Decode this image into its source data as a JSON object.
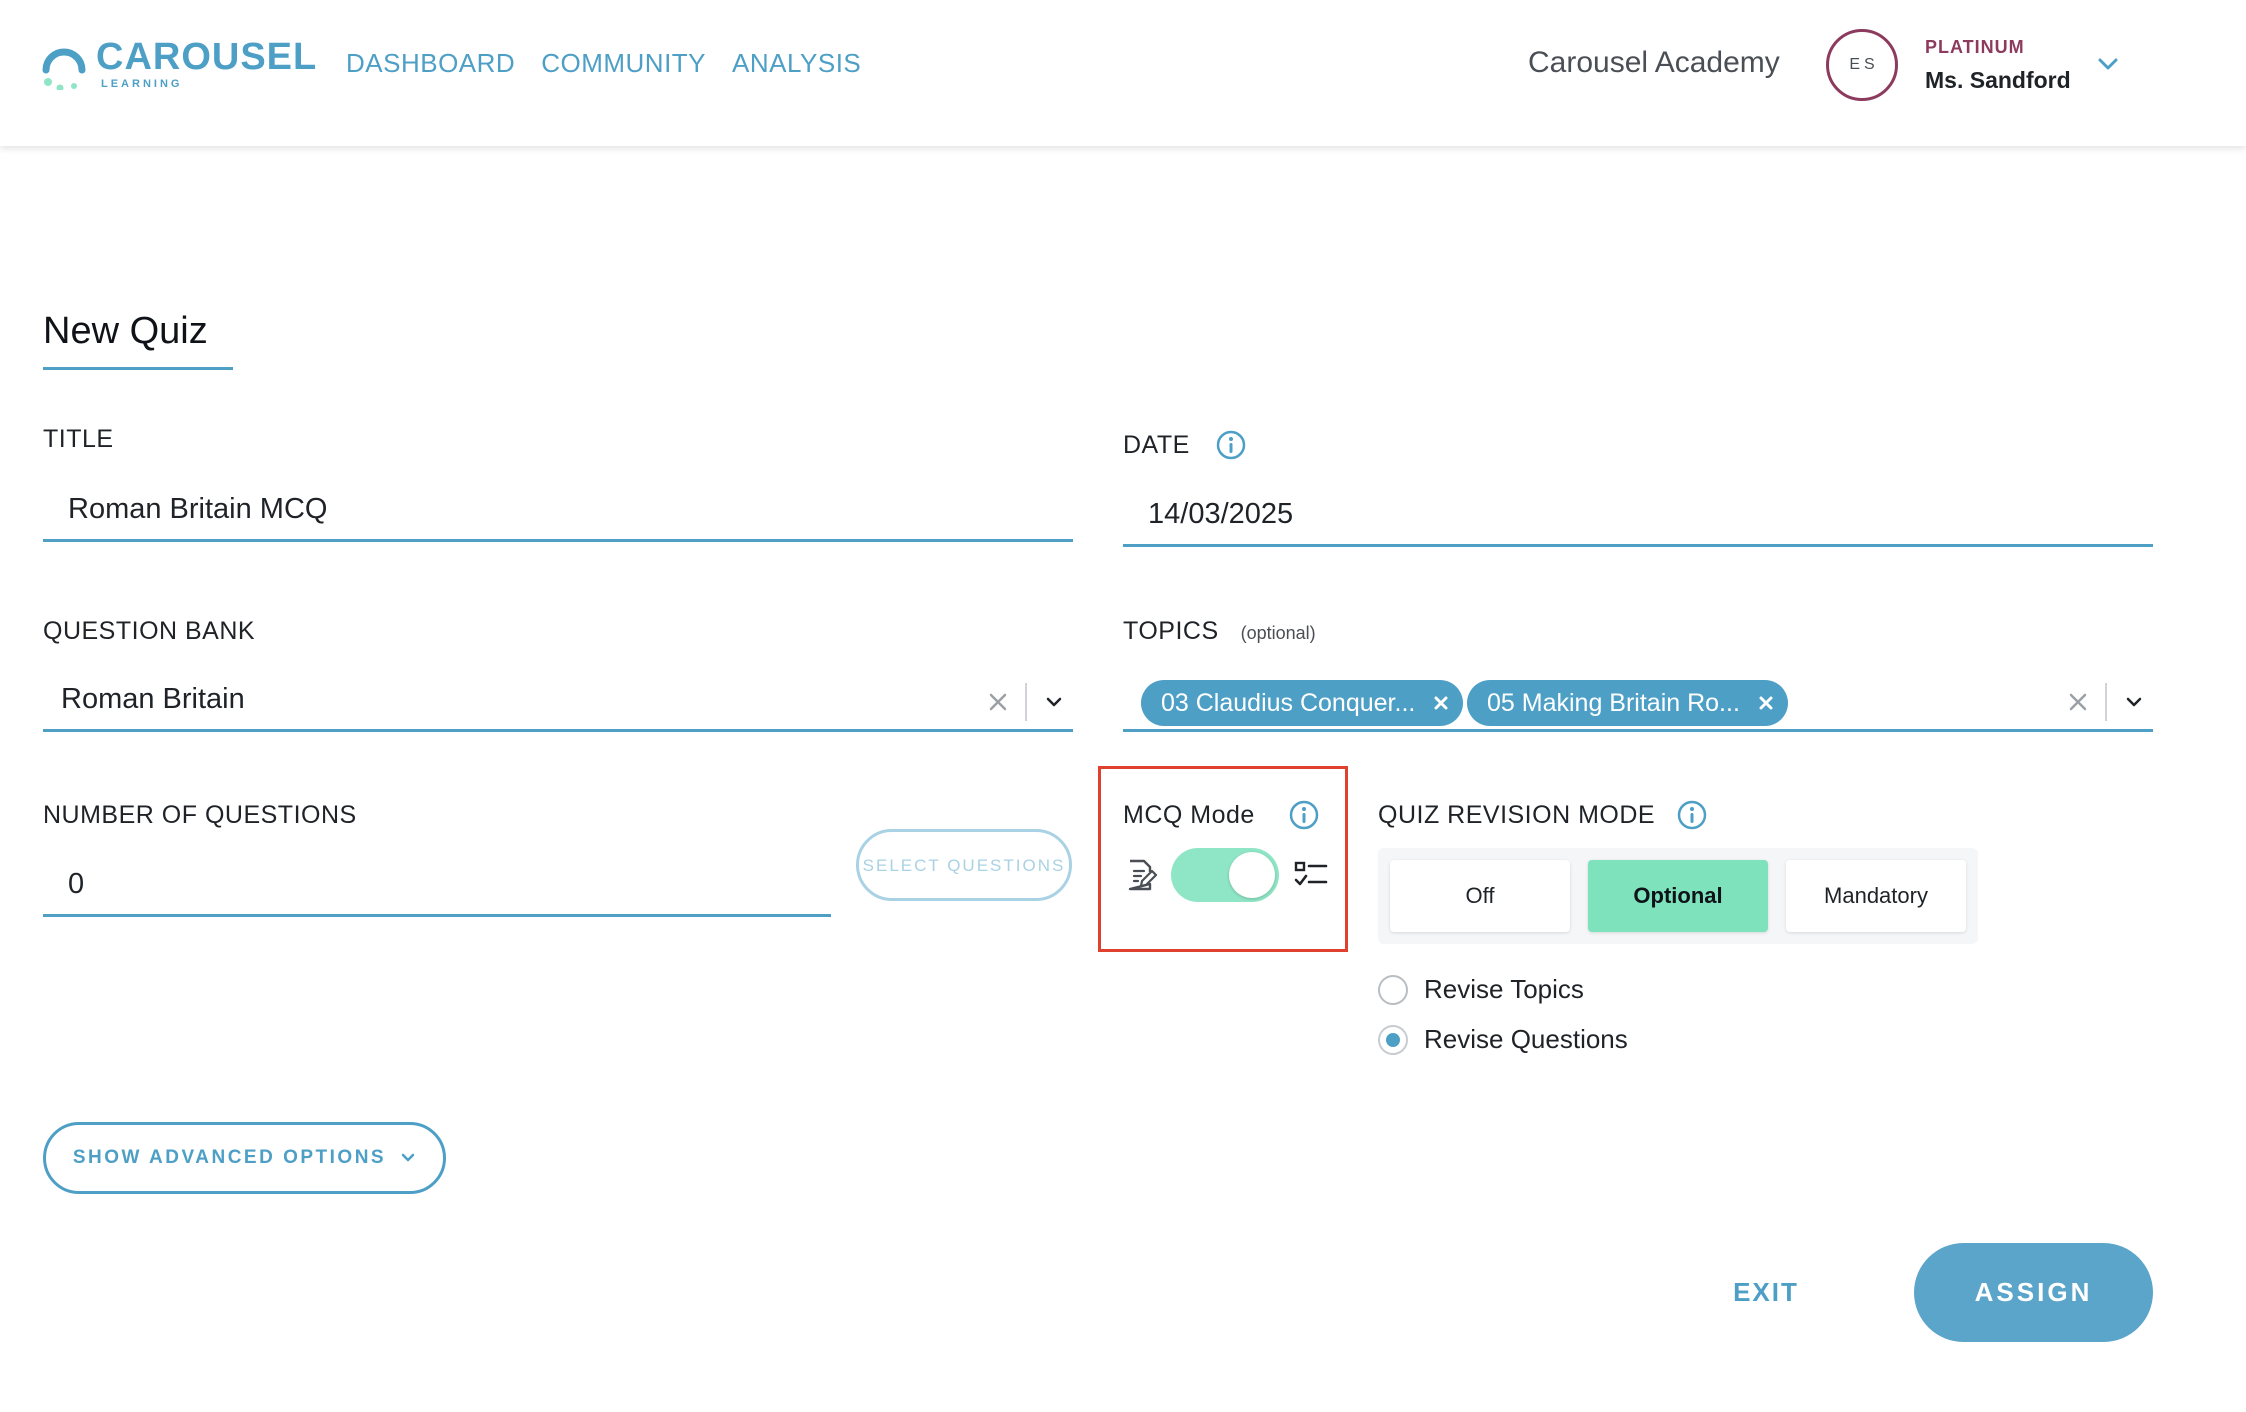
{
  "header": {
    "brand": "CAROUSEL",
    "brand_sub": "LEARNING",
    "nav": [
      "DASHBOARD",
      "COMMUNITY",
      "ANALYSIS"
    ],
    "school": "Carousel Academy",
    "avatar_initials": "ES",
    "plan": "PLATINUM",
    "user_name": "Ms. Sandford"
  },
  "page": {
    "title": "New Quiz"
  },
  "form": {
    "title_label": "TITLE",
    "title_value": "Roman Britain MCQ",
    "date_label": "DATE",
    "date_value": "14/03/2025",
    "bank_label": "QUESTION BANK",
    "bank_value": "Roman Britain",
    "topics_label": "TOPICS",
    "topics_optional": "(optional)",
    "topics": [
      "03 Claudius Conquer...",
      "05 Making Britain Ro..."
    ],
    "num_label": "NUMBER OF QUESTIONS",
    "num_value": "0",
    "select_questions": "SELECT QUESTIONS",
    "mcq_label": "MCQ Mode",
    "mcq_enabled": true,
    "revision_label": "QUIZ REVISION MODE",
    "revision_options": [
      "Off",
      "Optional",
      "Mandatory"
    ],
    "revision_selected": "Optional",
    "revise_options": [
      "Revise Topics",
      "Revise Questions"
    ],
    "revise_selected": "Revise Questions",
    "advanced_label": "SHOW ADVANCED OPTIONS"
  },
  "footer": {
    "exit": "EXIT",
    "assign": "ASSIGN"
  },
  "colors": {
    "accent": "#4d9fc6",
    "toggle": "#8fe6c6",
    "active_segment": "#7ee2bd",
    "plan": "#8c3b5e",
    "highlight_box": "#e0412e"
  }
}
